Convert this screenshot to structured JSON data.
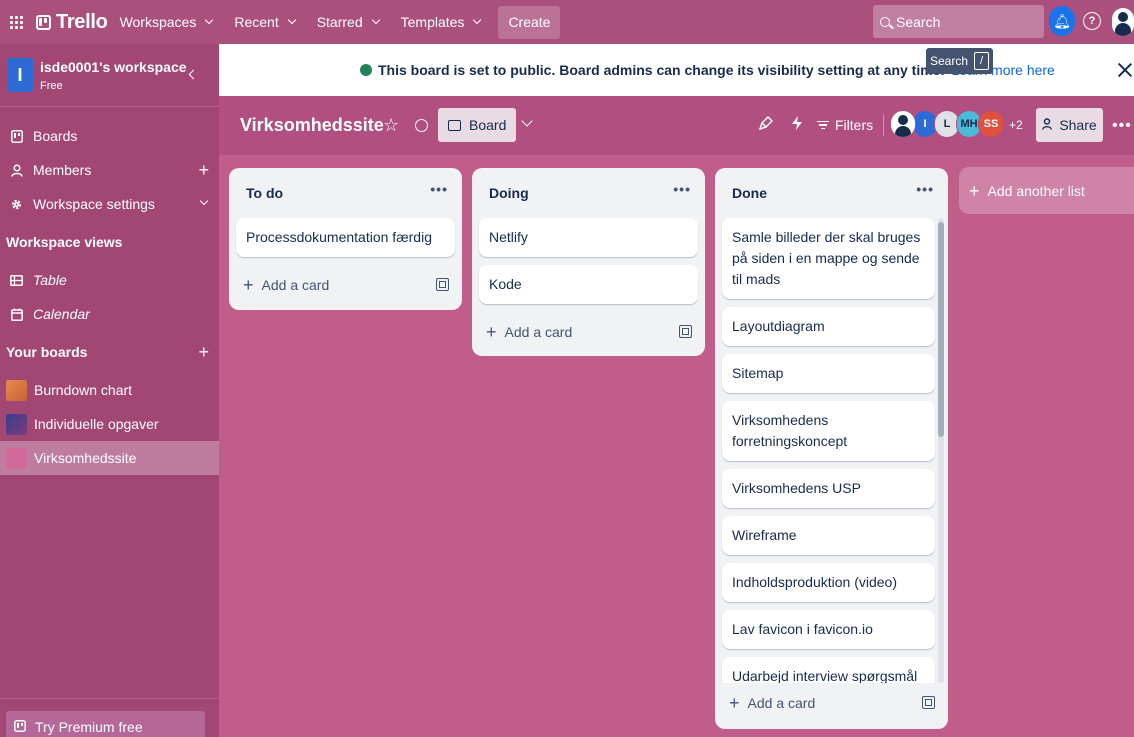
{
  "topnav": {
    "logo": "Trello",
    "menus": [
      "Workspaces",
      "Recent",
      "Starred",
      "Templates"
    ],
    "create_label": "Create",
    "search_placeholder": "Search"
  },
  "tooltip": {
    "label": "Search",
    "key": "/"
  },
  "banner": {
    "message": "This board is set to public. Board admins can change its visibility setting at any time.",
    "link": "Learn more here"
  },
  "sidebar": {
    "workspace_initial": "I",
    "workspace_name": "isde0001's workspace",
    "plan": "Free",
    "items": [
      {
        "label": "Boards",
        "icon": "trello-board-icon"
      },
      {
        "label": "Members",
        "icon": "person-icon"
      },
      {
        "label": "Workspace settings",
        "icon": "gear-icon"
      }
    ],
    "views_heading": "Workspace views",
    "views": [
      {
        "label": "Table",
        "icon": "table-icon"
      },
      {
        "label": "Calendar",
        "icon": "calendar-icon"
      }
    ],
    "boards_heading": "Your boards",
    "boards": [
      {
        "label": "Burndown chart",
        "color": "#e07a3f"
      },
      {
        "label": "Individuelle opgaver",
        "color": "#5b3a8a"
      },
      {
        "label": "Virksomhedssite",
        "color": "#d06a9a"
      }
    ],
    "premium": "Try Premium free"
  },
  "board": {
    "title": "Virksomhedssite",
    "view_label": "Board",
    "filters_label": "Filters",
    "members": [
      {
        "initials": "",
        "color": "#ffffff"
      },
      {
        "initials": "I",
        "color": "#2c6bd6"
      },
      {
        "initials": "L",
        "color": "#dfe1e6"
      },
      {
        "initials": "MH",
        "color": "#4bbad6"
      },
      {
        "initials": "SS",
        "color": "#e0513d"
      }
    ],
    "more_members": "+2",
    "share_label": "Share"
  },
  "lists": [
    {
      "name": "To do",
      "cards": [
        "Processdokumentation færdig"
      ],
      "add_label": "Add a card"
    },
    {
      "name": "Doing",
      "cards": [
        "Netlify",
        "Kode"
      ],
      "add_label": "Add a card"
    },
    {
      "name": "Done",
      "cards": [
        "Samle billeder der skal bruges på siden i en mappe og sende til mads",
        "Layoutdiagram",
        "Sitemap",
        "Virksomhedens forretningskoncept",
        "Virksomhedens USP",
        "Wireframe",
        "Indholdsproduktion (video)",
        "Lav favicon i favicon.io",
        "Udarbejd interview spørgsmål"
      ],
      "add_label": "Add a card"
    }
  ],
  "add_list_label": "Add another list",
  "colors": {
    "background": "#c05d8a",
    "nav": "#ab4f7d",
    "sidebar": "#a24674"
  }
}
